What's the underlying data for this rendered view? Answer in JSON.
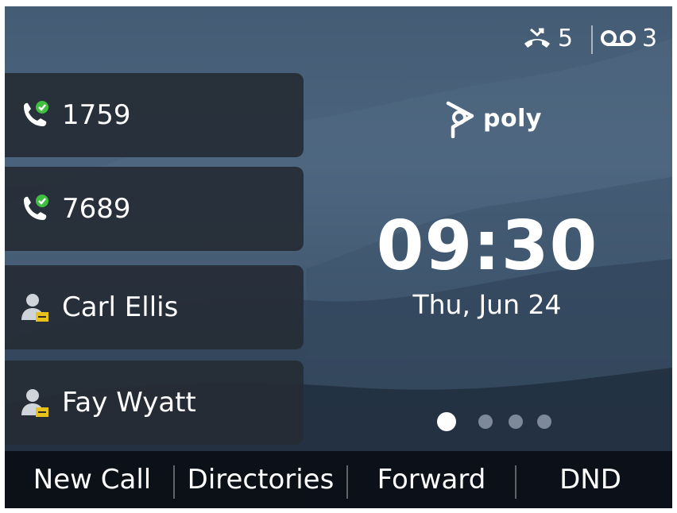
{
  "status_bar": {
    "missed_calls_icon": "missed-call-icon",
    "missed_calls_count": "5",
    "voicemail_icon": "voicemail-icon",
    "voicemail_count": "3"
  },
  "line_keys": [
    {
      "label": "1759",
      "icon": "phone-registered-icon"
    },
    {
      "label": "7689",
      "icon": "phone-registered-icon"
    },
    {
      "label": "Carl Ellis",
      "icon": "contact-icon"
    },
    {
      "label": "Fay Wyatt",
      "icon": "contact-icon"
    }
  ],
  "logo": {
    "text": "poly"
  },
  "clock": {
    "time": "09:30",
    "date": "Thu, Jun 24"
  },
  "pager": {
    "pages": 4,
    "active_page": 1
  },
  "soft_keys": [
    {
      "label": "New Call"
    },
    {
      "label": "Directories"
    },
    {
      "label": "Forward"
    },
    {
      "label": "DND"
    }
  ],
  "colors": {
    "status_ok": "#3fbf3f",
    "contact_badge": "#e8c21a"
  }
}
